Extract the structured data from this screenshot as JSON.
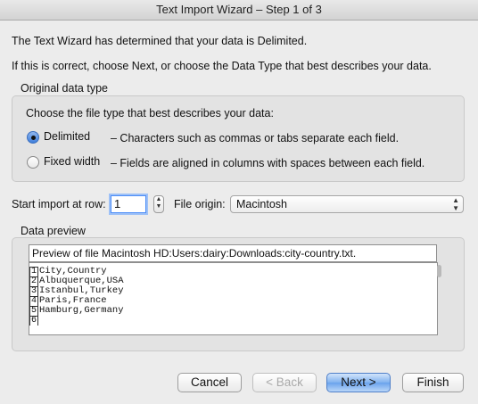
{
  "window": {
    "title": "Text Import Wizard – Step 1 of 3"
  },
  "intro": {
    "line1": "The Text Wizard has determined that your data is Delimited.",
    "line2": "If this is correct, choose Next, or choose the Data Type that best describes your data."
  },
  "original_data_type": {
    "legend": "Original data type",
    "prompt": "Choose the file type that best describes your data:",
    "options": [
      {
        "label": "Delimited",
        "description": "– Characters such as commas or tabs separate each field.",
        "selected": true
      },
      {
        "label": "Fixed width",
        "description": "– Fields are aligned in columns with spaces between each field.",
        "selected": false
      }
    ]
  },
  "start_import": {
    "label": "Start import at row:",
    "value": "1"
  },
  "file_origin": {
    "label": "File origin:",
    "value": "Macintosh"
  },
  "data_preview": {
    "legend": "Data preview",
    "header": "Preview of file Macintosh HD:Users:dairy:Downloads:city-country.txt.",
    "rows": [
      {
        "num": "1",
        "text": "City,Country"
      },
      {
        "num": "2",
        "text": "Albuquerque,USA"
      },
      {
        "num": "3",
        "text": "Istanbul,Turkey"
      },
      {
        "num": "4",
        "text": "Paris,France"
      },
      {
        "num": "5",
        "text": "Hamburg,Germany"
      },
      {
        "num": "6",
        "text": ""
      }
    ]
  },
  "buttons": {
    "cancel": "Cancel",
    "back": "< Back",
    "next": "Next >",
    "finish": "Finish"
  }
}
